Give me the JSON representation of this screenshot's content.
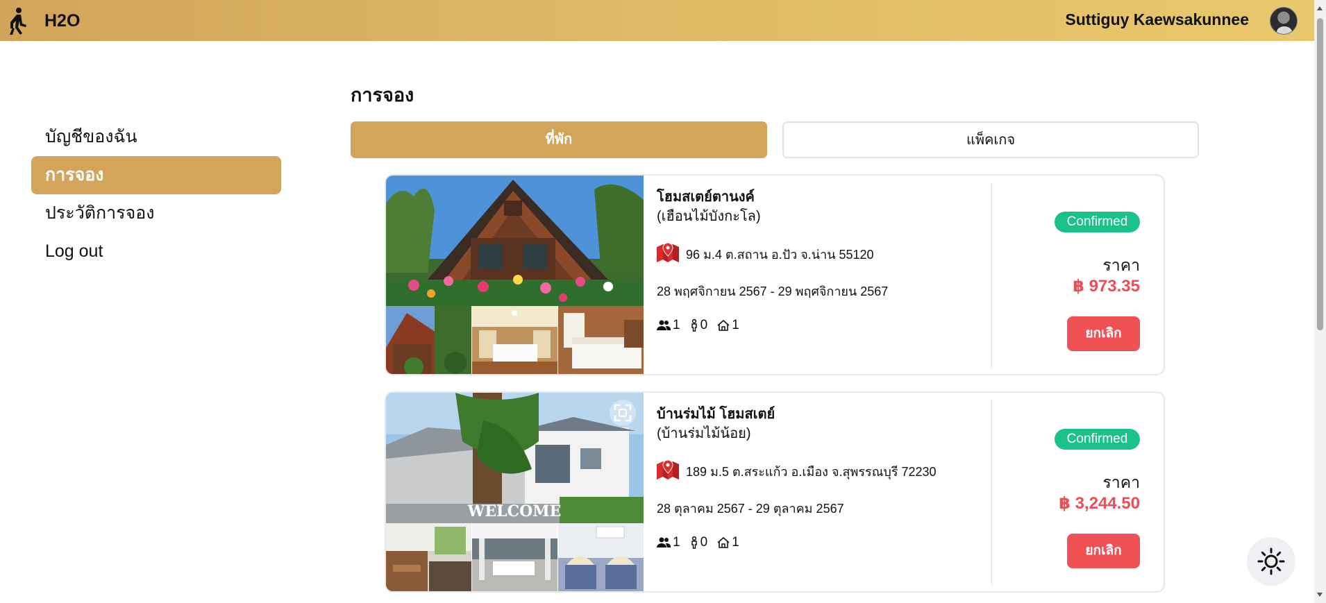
{
  "header": {
    "brand": "H2O",
    "user_name": "Suttiguy Kaewsakunnee"
  },
  "sidebar": {
    "items": [
      {
        "label": "บัญชีของฉัน",
        "active": false
      },
      {
        "label": "การจอง",
        "active": true
      },
      {
        "label": "ประวัติการจอง",
        "active": false
      },
      {
        "label": "Log out",
        "active": false
      }
    ]
  },
  "main": {
    "title": "การจอง",
    "tabs": [
      {
        "label": "ที่พัก",
        "active": true
      },
      {
        "label": "แพ็คเกจ",
        "active": false
      }
    ]
  },
  "bookings": [
    {
      "name": "โฮมสเตย์ตานงค์",
      "subname": "(เฮือนไม้บังกะโล)",
      "address": "96 ม.4 ต.สถาน อ.ปัว จ.น่าน 55120",
      "dates": "28 พฤศจิกายน 2567 - 29 พฤศจิกายน 2567",
      "adults": "1",
      "children": "0",
      "rooms": "1",
      "status": "Confirmed",
      "price_label": "ราคา",
      "price": "฿ 973.35",
      "cancel_label": "ยกเลิก"
    },
    {
      "name": "บ้านร่มไม้ โฮมสเตย์",
      "subname": "(บ้านร่มไม้น้อย)",
      "address": "189 ม.5 ต.สระแก้ว อ.เมือง จ.สุพรรณบุรี 72230",
      "dates": "28 ตุลาคม 2567 - 29 ตุลาคม 2567",
      "adults": "1",
      "children": "0",
      "rooms": "1",
      "status": "Confirmed",
      "price_label": "ราคา",
      "price": "฿ 3,244.50",
      "cancel_label": "ยกเลิก"
    }
  ],
  "photo_overlays": {
    "welcome_sign": "WELCOME"
  },
  "icons": {
    "logo": "walking-person-icon",
    "address": "map-pin-icon",
    "adults": "users-icon",
    "children": "child-icon",
    "rooms": "house-icon",
    "theme": "sun-icon",
    "expand": "expand-icon"
  },
  "colors": {
    "header_gradient_start": "#d2a45b",
    "header_gradient_end": "#e8c86c",
    "accent": "#d3a55b",
    "status_confirmed": "#1bc18a",
    "price": "#ee4d55",
    "cancel_button": "#ef5155"
  }
}
